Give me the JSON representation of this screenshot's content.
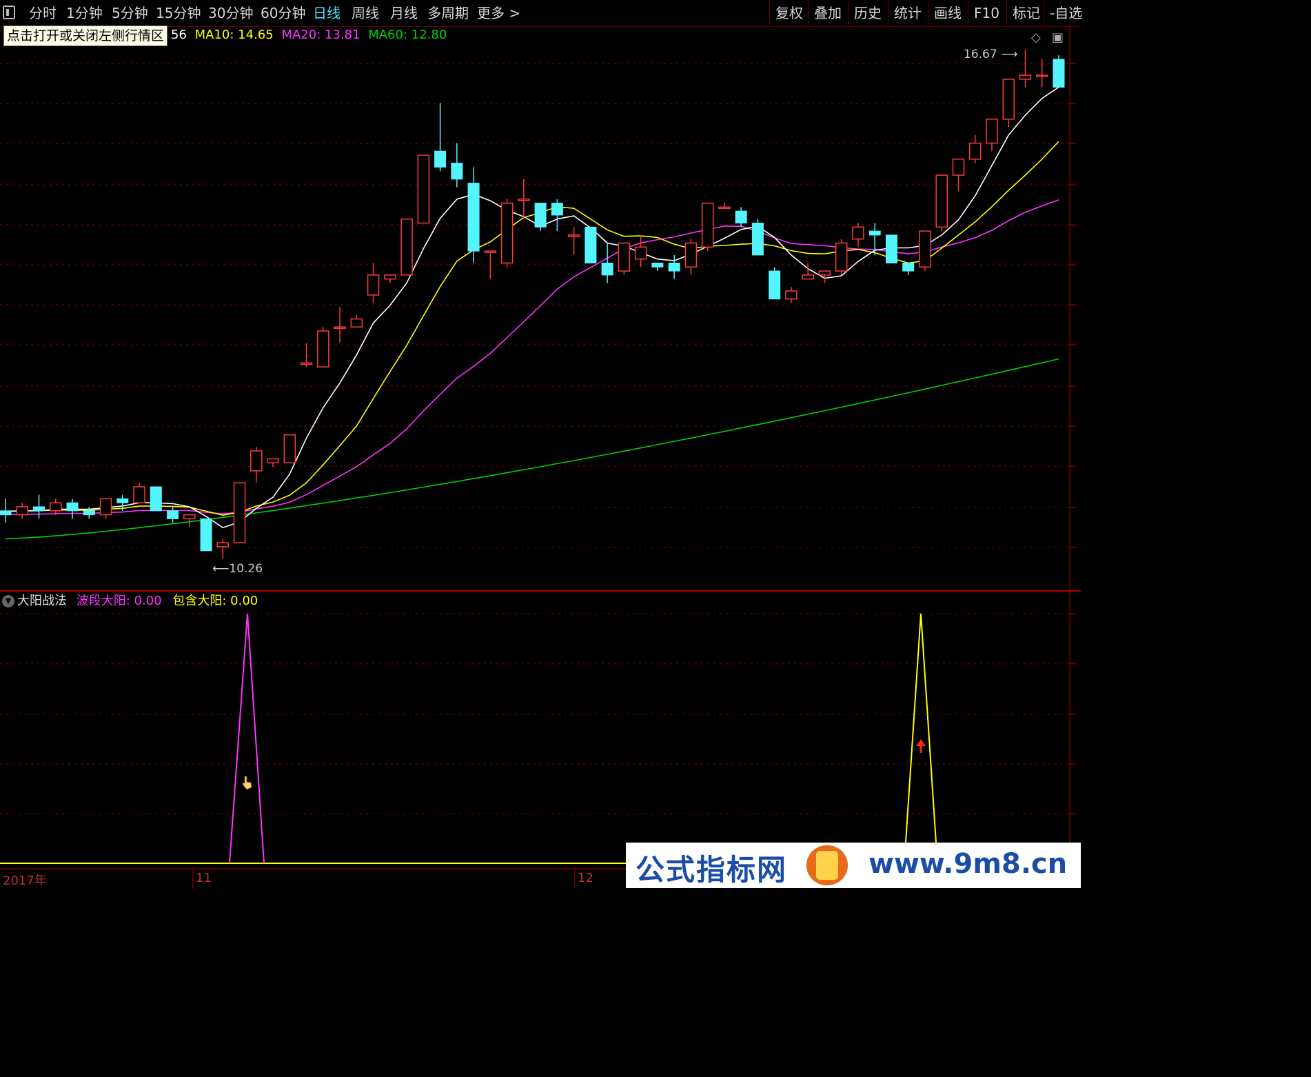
{
  "toolbar": {
    "periods": [
      "分时",
      "1分钟",
      "5分钟",
      "15分钟",
      "30分钟",
      "60分钟",
      "日线",
      "周线",
      "月线",
      "多周期",
      "更多 >"
    ],
    "active_period": "日线",
    "right_buttons": [
      "复权",
      "叠加",
      "历史",
      "统计",
      "画线",
      "F10",
      "标记",
      "-自选"
    ]
  },
  "tooltip": "点击打开或关闭左侧行情区",
  "ma_legend": {
    "ma5_tail": "56",
    "ma10": "MA10: 14.65",
    "ma20": "MA20: 13.81",
    "ma60": "MA60: 12.80"
  },
  "price_labels": {
    "high": "16.67",
    "low": "10.26"
  },
  "indicator": {
    "name": "大阳战法",
    "series1_label": "波段大阳:",
    "series1_value": "0.00",
    "series2_label": "包含大阳:",
    "series2_value": "0.00"
  },
  "date_axis": [
    "2017年",
    "11",
    "12"
  ],
  "watermark": {
    "left": "公式指标网",
    "right": "www.9m8.cn"
  },
  "colors": {
    "up": "#ff3b3b",
    "down": "#54f5ff",
    "ma5": "#ffffff",
    "ma10": "#ffff00",
    "ma20": "#ff33ff",
    "ma60": "#00d000",
    "grid": "#8b0000"
  },
  "chart_data": {
    "type": "candlestick",
    "ohlc": [
      [
        10.9,
        11.05,
        10.75,
        10.85
      ],
      [
        10.85,
        11.0,
        10.8,
        10.95
      ],
      [
        10.95,
        11.1,
        10.8,
        10.9
      ],
      [
        10.9,
        11.05,
        10.85,
        11.0
      ],
      [
        11.0,
        11.05,
        10.8,
        10.9
      ],
      [
        10.9,
        10.95,
        10.8,
        10.85
      ],
      [
        10.85,
        11.05,
        10.8,
        11.05
      ],
      [
        11.05,
        11.1,
        10.9,
        11.0
      ],
      [
        11.0,
        11.25,
        11.0,
        11.2
      ],
      [
        11.2,
        11.2,
        10.9,
        10.9
      ],
      [
        10.9,
        10.95,
        10.75,
        10.8
      ],
      [
        10.8,
        10.85,
        10.7,
        10.85
      ],
      [
        10.8,
        10.8,
        10.4,
        10.4
      ],
      [
        10.45,
        10.55,
        10.3,
        10.5
      ],
      [
        10.5,
        11.25,
        10.5,
        11.25
      ],
      [
        11.4,
        11.7,
        11.25,
        11.65
      ],
      [
        11.5,
        11.55,
        11.45,
        11.55
      ],
      [
        11.5,
        11.85,
        11.5,
        11.85
      ],
      [
        12.75,
        13.0,
        12.7,
        12.75
      ],
      [
        12.7,
        13.2,
        12.7,
        13.15
      ],
      [
        13.2,
        13.45,
        13.0,
        13.2
      ],
      [
        13.2,
        13.35,
        13.2,
        13.3
      ],
      [
        13.6,
        14.0,
        13.5,
        13.85
      ],
      [
        13.8,
        13.85,
        13.75,
        13.85
      ],
      [
        13.85,
        14.55,
        13.85,
        14.55
      ],
      [
        14.5,
        15.35,
        14.5,
        15.35
      ],
      [
        15.4,
        16.0,
        15.15,
        15.2
      ],
      [
        15.25,
        15.5,
        14.95,
        15.05
      ],
      [
        15.0,
        15.2,
        14.0,
        14.15
      ],
      [
        14.15,
        14.15,
        13.8,
        14.15
      ],
      [
        14.0,
        14.8,
        13.95,
        14.75
      ],
      [
        14.8,
        15.05,
        14.55,
        14.8
      ],
      [
        14.75,
        14.75,
        14.4,
        14.45
      ],
      [
        14.75,
        14.8,
        14.4,
        14.6
      ],
      [
        14.35,
        14.45,
        14.1,
        14.35
      ],
      [
        14.45,
        14.45,
        14.0,
        14.0
      ],
      [
        14.0,
        14.25,
        13.75,
        13.85
      ],
      [
        13.9,
        14.25,
        13.85,
        14.25
      ],
      [
        14.05,
        14.35,
        13.95,
        14.2
      ],
      [
        14.0,
        14.0,
        13.9,
        13.95
      ],
      [
        14.0,
        14.1,
        13.8,
        13.9
      ],
      [
        13.95,
        14.3,
        13.85,
        14.25
      ],
      [
        14.2,
        14.6,
        14.15,
        14.75
      ],
      [
        14.7,
        14.75,
        14.7,
        14.7
      ],
      [
        14.65,
        14.7,
        14.45,
        14.5
      ],
      [
        14.5,
        14.55,
        14.1,
        14.1
      ],
      [
        13.9,
        13.95,
        13.55,
        13.55
      ],
      [
        13.55,
        13.7,
        13.5,
        13.65
      ],
      [
        13.8,
        14.0,
        13.8,
        13.85
      ],
      [
        13.85,
        13.9,
        13.75,
        13.9
      ],
      [
        13.9,
        14.3,
        13.85,
        14.25
      ],
      [
        14.3,
        14.5,
        14.2,
        14.45
      ],
      [
        14.4,
        14.5,
        14.1,
        14.35
      ],
      [
        14.35,
        14.35,
        14.0,
        14.0
      ],
      [
        14.0,
        14.0,
        13.85,
        13.9
      ],
      [
        13.95,
        14.4,
        13.9,
        14.4
      ],
      [
        14.45,
        15.1,
        14.4,
        15.1
      ],
      [
        15.1,
        15.3,
        14.9,
        15.3
      ],
      [
        15.3,
        15.6,
        15.25,
        15.5
      ],
      [
        15.5,
        15.8,
        15.4,
        15.8
      ],
      [
        15.8,
        16.3,
        15.7,
        16.3
      ],
      [
        16.3,
        16.67,
        16.2,
        16.35
      ],
      [
        16.35,
        16.55,
        16.2,
        16.35
      ],
      [
        16.55,
        16.6,
        16.2,
        16.2
      ]
    ],
    "series": [
      {
        "name": "MA10",
        "last": 14.65
      },
      {
        "name": "MA20",
        "last": 13.81
      },
      {
        "name": "MA60",
        "last": 12.8
      }
    ],
    "high_label": 16.67,
    "low_label": 10.26,
    "indicator_series": [
      {
        "name": "波段大阳",
        "peak_index": 14,
        "peak_value": 1
      },
      {
        "name": "包含大阳",
        "peak_index": 54,
        "peak_value": 1
      }
    ]
  }
}
